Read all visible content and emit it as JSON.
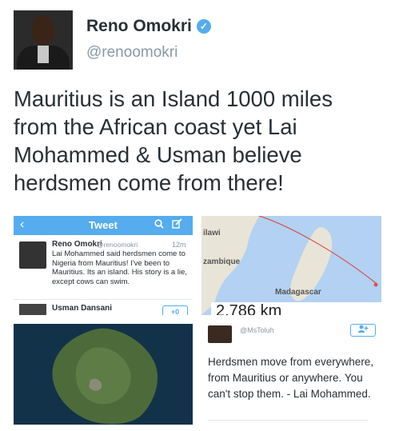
{
  "profile": {
    "name": "Reno Omokri",
    "handle": "@renoomokri",
    "verified_icon": "verified-badge-icon",
    "verified_color": "#55acee"
  },
  "tweet": {
    "text": "Mauritius is an Island 1000 miles from the African coast yet Lai Mohammed & Usman believe herdsmen come from there!"
  },
  "images": {
    "twitter_screenshot": {
      "header_title": "Tweet",
      "back_icon": "chevron-left-icon",
      "search_icon": "search-icon",
      "compose_icon": "compose-icon",
      "tweet_name": "Reno Omokri",
      "tweet_handle": "@renoomokri",
      "tweet_time": "12m",
      "tweet_body": "Lai Mohammed said herdsmen come to Nigeria from Mauritius! I've been to Mauritius. Its an island. His story is a lie, except cows can swim.",
      "next_user": "Usman Dansani",
      "follow_label": "+0",
      "accent": "#55acee"
    },
    "map": {
      "label_top": "ilawi",
      "label_mid": "zambique",
      "label_bottom": "Madagascar",
      "distance": "2,786 km",
      "route_color": "#d9534f"
    },
    "quote": {
      "handle": "@MsToluh",
      "text": "Herdsmen move from everywhere, from Mauritius or anywhere. You can't stop them. - Lai Mohammed."
    }
  }
}
